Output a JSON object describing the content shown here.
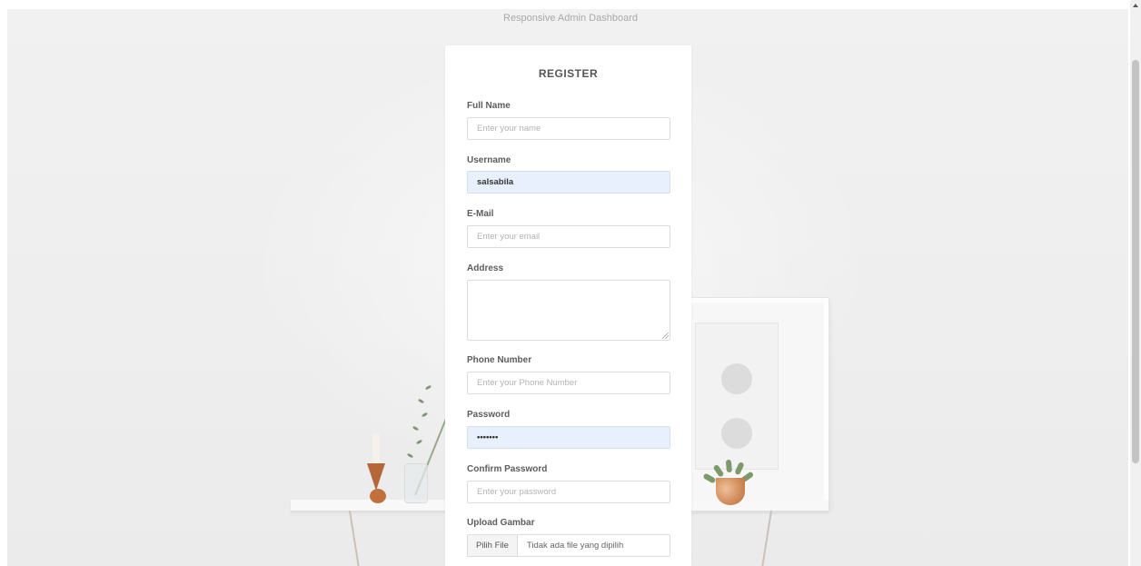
{
  "page": {
    "title": "Responsive Admin Dashboard"
  },
  "form": {
    "title": "REGISTER",
    "full_name": {
      "label": "Full Name",
      "placeholder": "Enter your name",
      "value": ""
    },
    "username": {
      "label": "Username",
      "placeholder": "",
      "value": "salsabila"
    },
    "email": {
      "label": "E-Mail",
      "placeholder": "Enter your email",
      "value": ""
    },
    "address": {
      "label": "Address",
      "value": ""
    },
    "phone": {
      "label": "Phone Number",
      "placeholder": "Enter your Phone Number",
      "value": ""
    },
    "password": {
      "label": "Password",
      "value": "•••••••"
    },
    "confirm_password": {
      "label": "Confirm Password",
      "placeholder": "Enter your password",
      "value": ""
    },
    "upload": {
      "label": "Upload Gambar",
      "button_label": "Pilih File",
      "status": "Tidak ada file yang dipilih"
    }
  },
  "colors": {
    "autofill_background": "#e8f0fe",
    "card_background": "#ffffff",
    "label_text": "#5c5c5c"
  }
}
